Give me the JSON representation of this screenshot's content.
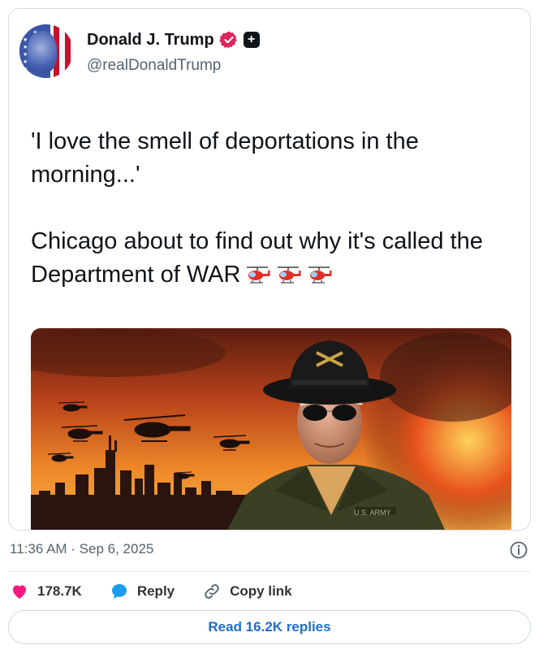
{
  "post": {
    "author": {
      "display_name": "Donald J. Trump",
      "handle": "@realDonaldTrump",
      "badges": [
        "verified-badge-icon",
        "plus-badge-icon"
      ]
    },
    "text_line1": "'I love the smell of deportations in the morning...'",
    "text_line2": "Chicago about to find out why it's called the Department of WAR",
    "emoji": [
      "helicopter",
      "helicopter",
      "helicopter"
    ],
    "media": {
      "uniform_text": "U.S. ARMY"
    },
    "timestamp": "11:36 AM · Sep 6, 2025"
  },
  "actions": {
    "likes_count": "178.7K",
    "reply_label": "Reply",
    "copy_link_label": "Copy link",
    "read_replies_label": "Read 16.2K replies"
  },
  "colors": {
    "like_red": "#f91880",
    "reply_blue": "#1d9bf0",
    "link_blue": "#1d6fd1",
    "secondary_text": "#536471",
    "verified_red": "#e0245e"
  }
}
